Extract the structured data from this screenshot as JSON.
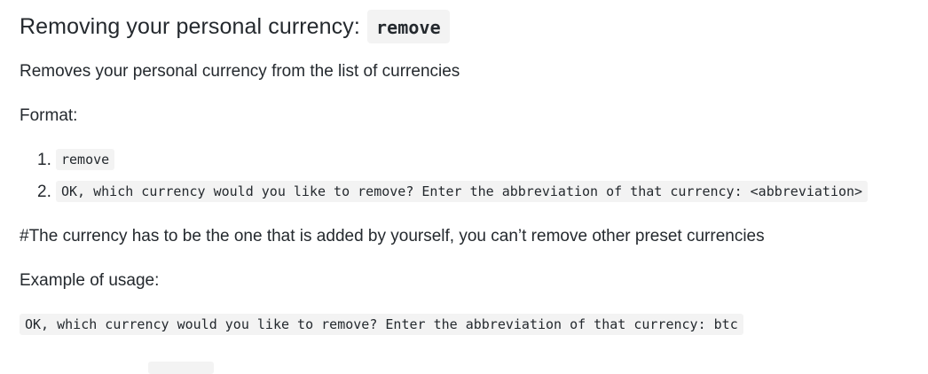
{
  "heading": {
    "text": "Removing your personal currency:",
    "code": "remove"
  },
  "description": "Removes your personal currency from the list of currencies",
  "format_label": "Format:",
  "format_steps": [
    {
      "number": "1.",
      "code": "remove"
    },
    {
      "number": "2.",
      "code": "OK, which currency would you like to remove? Enter the abbreviation of that currency: <abbreviation>"
    }
  ],
  "note": "#The currency has to be the one that is added by yourself, you can’t remove other preset currencies",
  "example_label": "Example of usage:",
  "example_code": "OK, which currency would you like to remove? Enter the abbreviation of that currency: btc"
}
